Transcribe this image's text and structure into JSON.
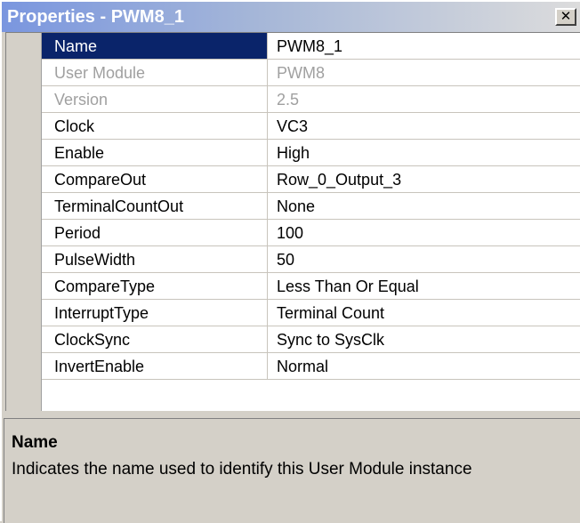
{
  "window": {
    "title": "Properties - PWM8_1",
    "close_glyph": "✕",
    "close_icon": "close-icon"
  },
  "properties": [
    {
      "name": "Name",
      "value": "PWM8_1",
      "state": "selected"
    },
    {
      "name": "User Module",
      "value": "PWM8",
      "state": "disabled"
    },
    {
      "name": "Version",
      "value": "2.5",
      "state": "disabled"
    },
    {
      "name": "Clock",
      "value": "VC3",
      "state": "normal"
    },
    {
      "name": "Enable",
      "value": "High",
      "state": "normal"
    },
    {
      "name": "CompareOut",
      "value": "Row_0_Output_3",
      "state": "normal"
    },
    {
      "name": "TerminalCountOut",
      "value": "None",
      "state": "normal"
    },
    {
      "name": "Period",
      "value": "100",
      "state": "normal"
    },
    {
      "name": "PulseWidth",
      "value": "50",
      "state": "normal"
    },
    {
      "name": "CompareType",
      "value": "Less Than Or Equal",
      "state": "normal"
    },
    {
      "name": "InterruptType",
      "value": "Terminal Count",
      "state": "normal"
    },
    {
      "name": "ClockSync",
      "value": "Sync to SysClk",
      "state": "normal"
    },
    {
      "name": "InvertEnable",
      "value": "Normal",
      "state": "normal"
    }
  ],
  "description": {
    "title": "Name",
    "text": "Indicates the name used to identify this User Module instance"
  },
  "colors": {
    "selection": "#0a246a",
    "title_gradient_start": "#7a96df",
    "disabled_text": "#a0a0a0",
    "face": "#d4d0c8"
  }
}
